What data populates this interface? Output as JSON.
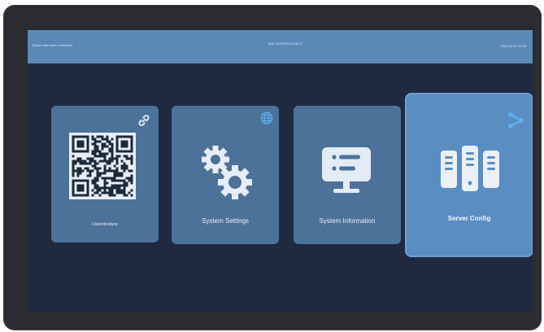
{
  "status_bar": {
    "left_text": "Server has been connected",
    "center_text": "MAC:AI:E0:FH:H:2E:1T",
    "right_text": "2022-10-17 10:09"
  },
  "tiles": {
    "intro": {
      "label": "UserIntroduce"
    },
    "settings": {
      "label": "System Settings"
    },
    "info": {
      "label": "System Information"
    },
    "server": {
      "label": "Server Config"
    }
  },
  "icons": {
    "link": "link-icon",
    "globe": "globe-icon",
    "share": "share-icon",
    "gear": "gear-icon",
    "monitor": "monitor-icon",
    "servers": "server-rack-icon",
    "qr": "qr-code"
  },
  "colors": {
    "status_bar": "#5b89b7",
    "screen_bg": "#1f2a40",
    "tile": "#4d729a",
    "tile_selected": "#5a8dc2",
    "accent_icon": "#5fb0f0",
    "icon_light": "#dce6f1"
  }
}
